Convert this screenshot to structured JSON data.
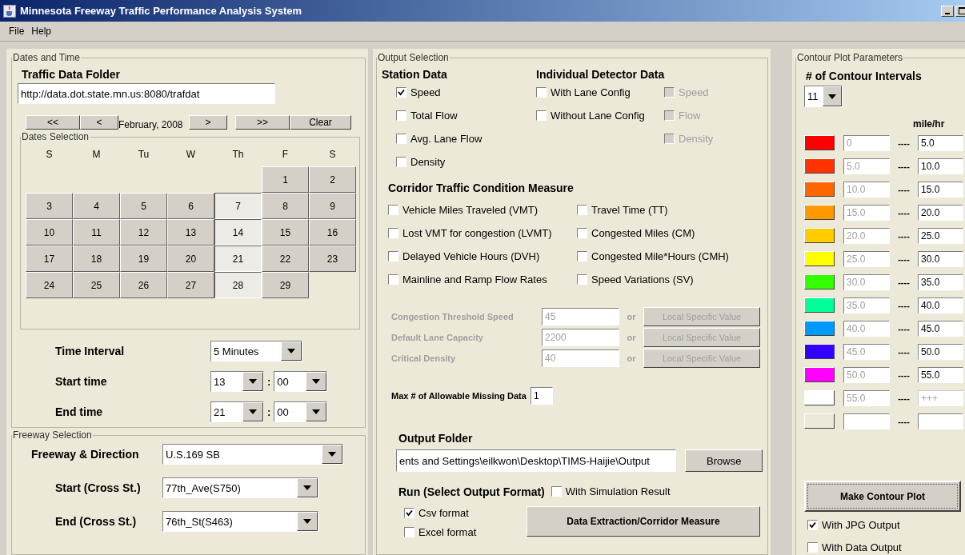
{
  "window": {
    "title": "Minnesota Freeway Traffic Performance Analysis System"
  },
  "menu": [
    "File",
    "Help"
  ],
  "dates_and_time": {
    "title": "Dates and Time",
    "folder_label": "Traffic Data Folder",
    "folder": "http://data.dot.state.mn.us:8080/trafdat",
    "nav": {
      "prev_year": "<<",
      "prev_month": "<",
      "month": "February, 2008",
      "next_month": ">",
      "next_year": ">>",
      "clear": "Clear"
    },
    "calendar": {
      "title": "Dates Selection",
      "weekdays": [
        "S",
        "M",
        "Tu",
        "W",
        "Th",
        "F",
        "S"
      ],
      "weeks": [
        {
          "days": [
            {
              "label": "1",
              "selected": false
            },
            {
              "label": "2",
              "selected": false
            }
          ]
        },
        {
          "days": [
            {
              "label": "3",
              "selected": false
            },
            {
              "label": "4",
              "selected": false
            },
            {
              "label": "5",
              "selected": false
            },
            {
              "label": "6",
              "selected": false
            },
            {
              "label": "7",
              "selected": true
            },
            {
              "label": "8",
              "selected": false
            },
            {
              "label": "9",
              "selected": false
            }
          ]
        },
        {
          "days": [
            {
              "label": "10",
              "selected": false
            },
            {
              "label": "11",
              "selected": false
            },
            {
              "label": "12",
              "selected": false
            },
            {
              "label": "13",
              "selected": false
            },
            {
              "label": "14",
              "selected": true
            },
            {
              "label": "15",
              "selected": false
            },
            {
              "label": "16",
              "selected": false
            }
          ]
        },
        {
          "days": [
            {
              "label": "17",
              "selected": false
            },
            {
              "label": "18",
              "selected": false
            },
            {
              "label": "19",
              "selected": false
            },
            {
              "label": "20",
              "selected": false
            },
            {
              "label": "21",
              "selected": true
            },
            {
              "label": "22",
              "selected": false
            },
            {
              "label": "23",
              "selected": false
            }
          ]
        },
        {
          "days": [
            {
              "label": "24",
              "selected": false
            },
            {
              "label": "25",
              "selected": false
            },
            {
              "label": "26",
              "selected": false
            },
            {
              "label": "27",
              "selected": false
            },
            {
              "label": "28",
              "selected": true
            },
            {
              "label": "29",
              "selected": false
            }
          ]
        }
      ]
    },
    "time_interval": {
      "label": "Time Interval",
      "value": "5 Minutes"
    },
    "times": [
      {
        "label": "Start time",
        "hour": "13",
        "separator": ":",
        "minute": "00"
      },
      {
        "label": "End time",
        "hour": "21",
        "separator": ":",
        "minute": "00"
      }
    ]
  },
  "freeway_selection": {
    "title": "Freeway Selection",
    "fields": [
      {
        "kind": "primary",
        "label": "Freeway & Direction",
        "value": "U.S.169 SB"
      },
      {
        "kind": "cross",
        "label": "Start (Cross St.)",
        "value": "77th_Ave(S750)"
      },
      {
        "kind": "cross",
        "label": "End (Cross St.)",
        "value": "76th_St(S463)"
      }
    ]
  },
  "output_selection": {
    "title": "Output Selection",
    "station": {
      "title": "Station Data",
      "options": [
        {
          "label": "Speed",
          "checked": true
        },
        {
          "label": "Total Flow",
          "checked": false
        },
        {
          "label": "Avg. Lane Flow",
          "checked": false
        },
        {
          "label": "Density",
          "checked": false
        }
      ]
    },
    "detector": {
      "title": "Individual Detector Data",
      "options": [
        {
          "label": "With Lane Config",
          "checked": false
        },
        {
          "label": "Without Lane Config",
          "checked": false
        }
      ],
      "measures": [
        {
          "label": "Speed",
          "checked": false,
          "disabled": true
        },
        {
          "label": "Flow",
          "checked": false,
          "disabled": true
        },
        {
          "label": "Density",
          "checked": false,
          "disabled": true
        }
      ]
    },
    "corridor": {
      "title": "Corridor Traffic Condition Measure",
      "options": [
        {
          "label": "Vehicle Miles Traveled (VMT)",
          "checked": false
        },
        {
          "label": "Travel Time (TT)",
          "checked": false
        },
        {
          "label": "Lost VMT for congestion (LVMT)",
          "checked": false
        },
        {
          "label": "Congested Miles (CM)",
          "checked": false
        },
        {
          "label": "Delayed Vehicle Hours (DVH)",
          "checked": false
        },
        {
          "label": "Congested Mile*Hours (CMH)",
          "checked": false
        },
        {
          "label": "Mainline and Ramp Flow Rates",
          "checked": false
        },
        {
          "label": "Speed Variations (SV)",
          "checked": false
        }
      ]
    },
    "thresholds": {
      "disabled": true,
      "rows": [
        {
          "label": "Congestion Threshold Speed",
          "value": "45",
          "or": "or",
          "button": "Local Specific Value"
        },
        {
          "label": "Default Lane Capacity",
          "value": "2200",
          "or": "or",
          "button": "Local Specific Value"
        },
        {
          "label": "Critical Density",
          "value": "40",
          "or": "or",
          "button": "Local Specific Value"
        }
      ]
    },
    "missing": {
      "label": "Max # of Allowable Missing Data",
      "value": "1"
    },
    "output_folder": {
      "label": "Output Folder",
      "value": "ents and Settings\\eilkwon\\Desktop\\TIMS-Haijie\\Output",
      "button": "Browse"
    },
    "run": {
      "label": "Run (Select Output Format)",
      "simulation": {
        "label": "With Simulation Result",
        "checked": false
      },
      "formats": [
        {
          "label": "Csv format",
          "checked": true
        },
        {
          "label": "Excel format",
          "checked": false
        }
      ],
      "button": "Data Extraction/Corridor Measure"
    }
  },
  "contour": {
    "title": "Contour Plot Parameters",
    "intervals_label": "# of Contour Intervals",
    "intervals": "11",
    "unit": "mile/hr",
    "rows": [
      {
        "color": "#ff0000",
        "from": "0",
        "separator": "----",
        "to": "5.0",
        "to_disabled": false
      },
      {
        "color": "#ff3300",
        "from": "5.0",
        "separator": "----",
        "to": "10.0",
        "to_disabled": false
      },
      {
        "color": "#ff6600",
        "from": "10.0",
        "separator": "----",
        "to": "15.0",
        "to_disabled": false
      },
      {
        "color": "#ff9900",
        "from": "15.0",
        "separator": "----",
        "to": "20.0",
        "to_disabled": false
      },
      {
        "color": "#ffcc00",
        "from": "20.0",
        "separator": "----",
        "to": "25.0",
        "to_disabled": false
      },
      {
        "color": "#ffff00",
        "from": "25.0",
        "separator": "----",
        "to": "30.0",
        "to_disabled": false
      },
      {
        "color": "#33ff00",
        "from": "30.0",
        "separator": "----",
        "to": "35.0",
        "to_disabled": false
      },
      {
        "color": "#00ff99",
        "from": "35.0",
        "separator": "----",
        "to": "40.0",
        "to_disabled": false
      },
      {
        "color": "#0099ff",
        "from": "40.0",
        "separator": "----",
        "to": "45.0",
        "to_disabled": false
      },
      {
        "color": "#3300ff",
        "from": "45.0",
        "separator": "----",
        "to": "50.0",
        "to_disabled": false
      },
      {
        "color": "#ff00ff",
        "from": "50.0",
        "separator": "----",
        "to": "55.0",
        "to_disabled": false
      },
      {
        "color": "#ffffff",
        "from": "55.0",
        "separator": "----",
        "to": "+++",
        "to_disabled": true
      },
      {
        "color": "#ece9d8",
        "separator": "----",
        "to_disabled": false
      }
    ],
    "button": "Make Contour Plot",
    "options": [
      {
        "label": "With JPG Output",
        "checked": true
      },
      {
        "label": "With Data Output",
        "checked": false
      }
    ]
  }
}
